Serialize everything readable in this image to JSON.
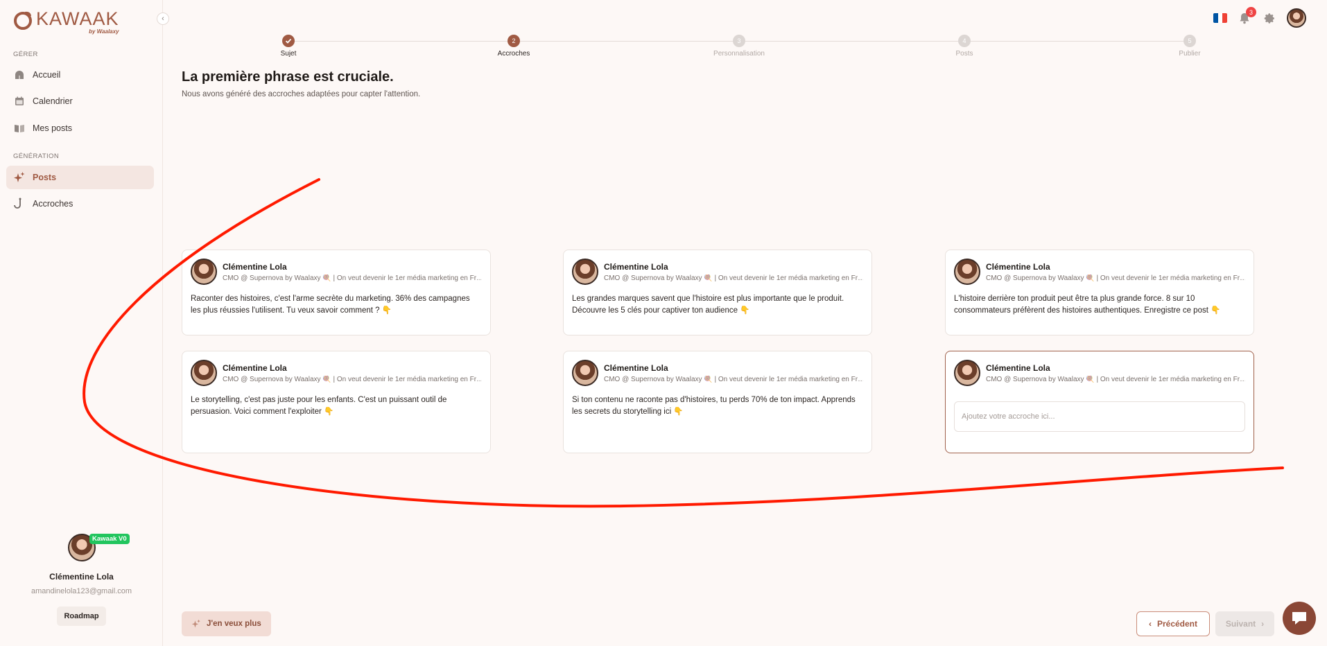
{
  "brand": {
    "name": "KAWAAK",
    "by": "by Waalaxy"
  },
  "sidebar": {
    "section_manage": "GÉRER",
    "section_generation": "GÉNÉRATION",
    "manage_items": [
      {
        "label": "Accueil",
        "icon": "home-icon"
      },
      {
        "label": "Calendrier",
        "icon": "calendar-icon"
      },
      {
        "label": "Mes posts",
        "icon": "folder-icon"
      }
    ],
    "generation_items": [
      {
        "label": "Posts",
        "icon": "sparkles-icon",
        "active": true
      },
      {
        "label": "Accroches",
        "icon": "hook-icon",
        "active": false
      }
    ]
  },
  "profile": {
    "badge": "Kawaak V0",
    "name": "Clémentine Lola",
    "email": "amandinelola123@gmail.com",
    "roadmap": "Roadmap"
  },
  "header": {
    "notifications_count": "3",
    "flag_colors": [
      "#0055a4",
      "#ffffff",
      "#ef4135"
    ]
  },
  "stepper": {
    "steps": [
      {
        "number": "1",
        "label": "Sujet",
        "state": "done"
      },
      {
        "number": "2",
        "label": "Accroches",
        "state": "current"
      },
      {
        "number": "3",
        "label": "Personnalisation",
        "state": "todo"
      },
      {
        "number": "4",
        "label": "Posts",
        "state": "todo"
      },
      {
        "number": "5",
        "label": "Publier",
        "state": "todo"
      }
    ]
  },
  "main": {
    "title": "La première phrase est cruciale.",
    "subtitle": "Nous avons généré des accroches adaptées pour capter l'attention."
  },
  "cards": [
    {
      "author": "Clémentine Lola",
      "role": "CMO @ Supernova by Waalaxy 🍭 | On veut devenir le 1er média marketing en France",
      "text": "Raconter des histoires, c'est l'arme secrète du marketing. 36% des campagnes les plus réussies l'utilisent. Tu veux savoir comment ? 👇"
    },
    {
      "author": "Clémentine Lola",
      "role": "CMO @ Supernova by Waalaxy 🍭 | On veut devenir le 1er média marketing en France",
      "text": "Les grandes marques savent que l'histoire est plus importante que le produit. Découvre les 5 clés pour captiver ton audience 👇"
    },
    {
      "author": "Clémentine Lola",
      "role": "CMO @ Supernova by Waalaxy 🍭 | On veut devenir le 1er média marketing en France",
      "text": "L'histoire derrière ton produit peut être ta plus grande force. 8 sur 10 consommateurs préfèrent des histoires authentiques. Enregistre ce post 👇"
    },
    {
      "author": "Clémentine Lola",
      "role": "CMO @ Supernova by Waalaxy 🍭 | On veut devenir le 1er média marketing en France",
      "text": "Le storytelling, c'est pas juste pour les enfants. C'est un puissant outil de persuasion. Voici comment l'exploiter 👇"
    },
    {
      "author": "Clémentine Lola",
      "role": "CMO @ Supernova by Waalaxy 🍭 | On veut devenir le 1er média marketing en France",
      "text": "Si ton contenu ne raconte pas d'histoires, tu perds 70% de ton impact. Apprends les secrets du storytelling ici 👇"
    }
  ],
  "custom_card": {
    "author": "Clémentine Lola",
    "role": "CMO @ Supernova by Waalaxy 🍭 | On veut devenir le 1er média marketing en France",
    "input_value": "",
    "input_placeholder": "Ajoutez votre accroche ici..."
  },
  "footer": {
    "more_label": "J'en veux plus",
    "prev_label": "Précédent",
    "next_label": "Suivant"
  },
  "colors": {
    "accent": "#a05a43",
    "annotation": "#ff1a00"
  }
}
